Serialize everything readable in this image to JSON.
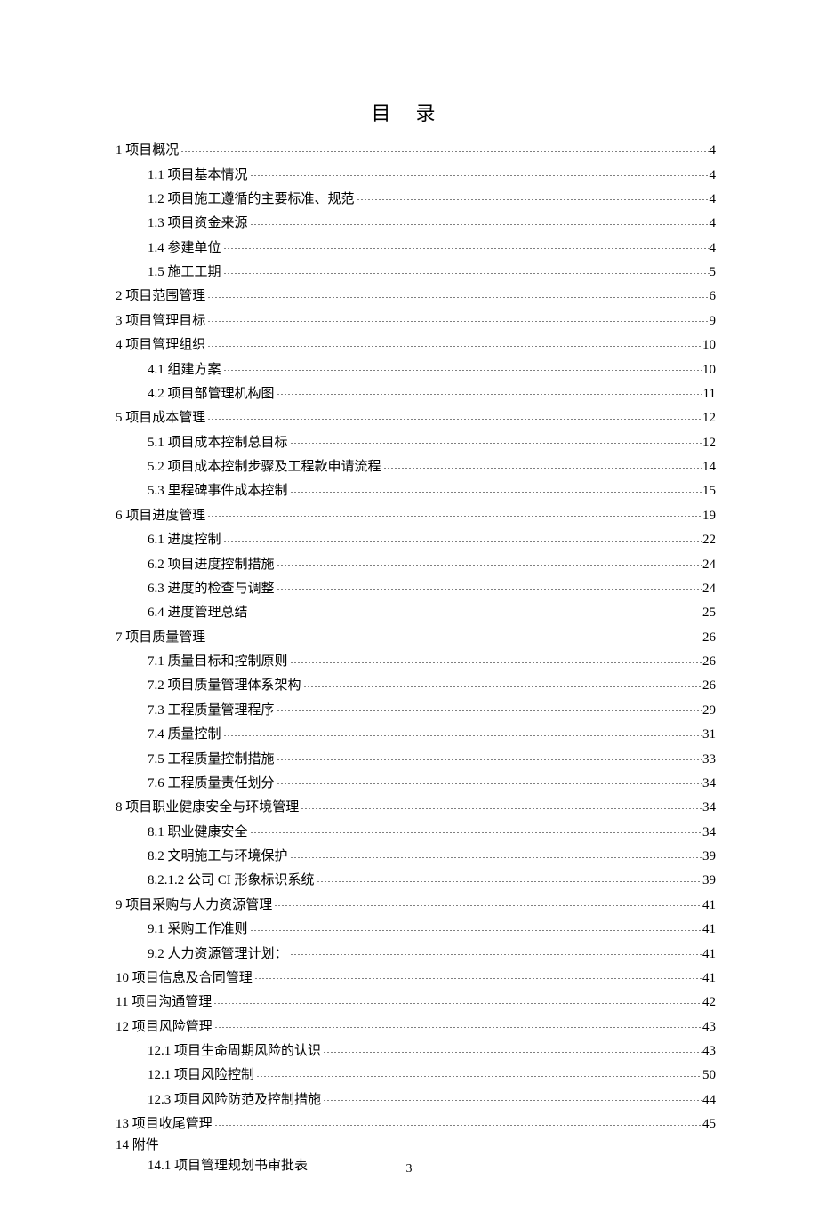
{
  "title": "目录",
  "page_number": "3",
  "toc": [
    {
      "indent": 0,
      "num": "1",
      "title": "项目概况",
      "page": "4"
    },
    {
      "indent": 1,
      "num": "1.1",
      "title": "项目基本情况",
      "page": "4"
    },
    {
      "indent": 1,
      "num": "1.2",
      "title": "项目施工遵循的主要标准、规范",
      "page": "4"
    },
    {
      "indent": 1,
      "num": "1.3",
      "title": "项目资金来源",
      "page": "4"
    },
    {
      "indent": 1,
      "num": "1.4",
      "title": "参建单位",
      "page": "4"
    },
    {
      "indent": 1,
      "num": "1.5",
      "title": "施工工期",
      "page": "5"
    },
    {
      "indent": 0,
      "num": "2",
      "title": "项目范围管理",
      "page": "6"
    },
    {
      "indent": 0,
      "num": "3",
      "title": "项目管理目标",
      "page": "9"
    },
    {
      "indent": 0,
      "num": "4",
      "title": "项目管理组织",
      "page": "10"
    },
    {
      "indent": 1,
      "num": "4.1",
      "title": "组建方案",
      "page": "10"
    },
    {
      "indent": 1,
      "num": "4.2",
      "title": " 项目部管理机构图",
      "page": "11"
    },
    {
      "indent": 0,
      "num": "5",
      "title": "项目成本管理",
      "page": "12"
    },
    {
      "indent": 1,
      "num": "5.1",
      "title": "项目成本控制总目标",
      "page": "12"
    },
    {
      "indent": 1,
      "num": "5.2",
      "title": "项目成本控制步骤及工程款申请流程",
      "page": "14"
    },
    {
      "indent": 1,
      "num": "5.3",
      "title": "里程碑事件成本控制",
      "page": "15"
    },
    {
      "indent": 0,
      "num": "6",
      "title": "项目进度管理",
      "page": "19"
    },
    {
      "indent": 1,
      "num": "6.1",
      "title": "进度控制",
      "page": "22"
    },
    {
      "indent": 1,
      "num": "6.2",
      "title": "项目进度控制措施",
      "page": "24"
    },
    {
      "indent": 1,
      "num": "6.3",
      "title": "进度的检查与调整",
      "page": "24"
    },
    {
      "indent": 1,
      "num": "6.4",
      "title": "进度管理总结",
      "page": "25"
    },
    {
      "indent": 0,
      "num": "7",
      "title": "项目质量管理",
      "page": "26"
    },
    {
      "indent": 1,
      "num": "7.1",
      "title": "质量目标和控制原则",
      "page": "26"
    },
    {
      "indent": 1,
      "num": "7.2",
      "title": "项目质量管理体系架构",
      "page": "26"
    },
    {
      "indent": 1,
      "num": "7.3",
      "title": "工程质量管理程序",
      "page": "29"
    },
    {
      "indent": 1,
      "num": "7.4",
      "title": "质量控制",
      "page": "31"
    },
    {
      "indent": 1,
      "num": "7.5",
      "title": "工程质量控制措施",
      "page": "33"
    },
    {
      "indent": 1,
      "num": "7.6",
      "title": "工程质量责任划分",
      "page": "34"
    },
    {
      "indent": 0,
      "num": "8",
      "title": "项目职业健康安全与环境管理",
      "page": "34"
    },
    {
      "indent": 1,
      "num": "8.1",
      "title": "职业健康安全",
      "page": "34"
    },
    {
      "indent": 1,
      "num": "8.2",
      "title": "文明施工与环境保护",
      "page": "39"
    },
    {
      "indent": 1,
      "num": "8.2.1.2",
      "title": " 公司 CI 形象标识系统",
      "page": "39"
    },
    {
      "indent": 0,
      "num": "9",
      "title": "项目采购与人力资源管理",
      "page": "41"
    },
    {
      "indent": 1,
      "num": "9.1",
      "title": "采购工作准则",
      "page": "41"
    },
    {
      "indent": 1,
      "num": "9.2",
      "title": " 人力资源管理计划：",
      "page": "41"
    },
    {
      "indent": 0,
      "num": "10",
      "title": "项目信息及合同管理",
      "page": "41"
    },
    {
      "indent": 0,
      "num": "11",
      "title": "项目沟通管理",
      "page": "42"
    },
    {
      "indent": 0,
      "num": "12",
      "title": "项目风险管理",
      "page": "43"
    },
    {
      "indent": 1,
      "num": "12.1",
      "title": "项目生命周期风险的认识",
      "page": "43"
    },
    {
      "indent": 1,
      "num": "12.1",
      "title": "项目风险控制",
      "page": "50"
    },
    {
      "indent": 1,
      "num": "12.3",
      "title": "项目风险防范及控制措施",
      "page": "44"
    },
    {
      "indent": 0,
      "num": "13",
      "title": "项目收尾管理",
      "page": "45"
    },
    {
      "indent": 0,
      "num": "14",
      "title": " 附件",
      "page": ""
    },
    {
      "indent": 1,
      "num": "14.1",
      "title": "项目管理规划书审批表",
      "page": ""
    }
  ]
}
